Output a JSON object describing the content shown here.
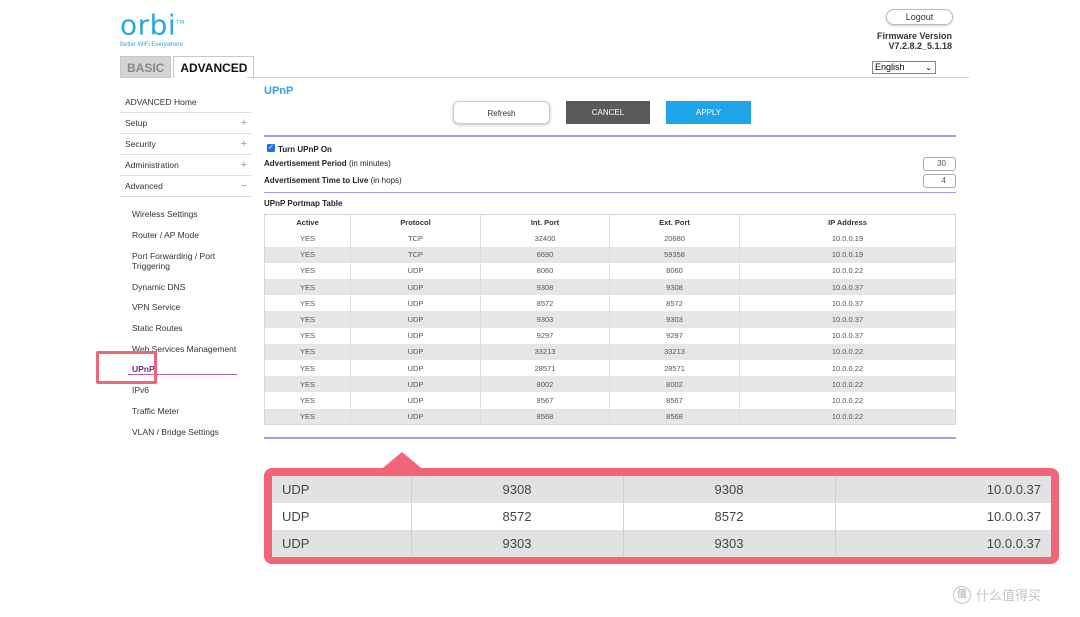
{
  "brand": {
    "logo": "orbi",
    "trademark": "TM",
    "tagline": "Better WiFi Everywhere"
  },
  "header": {
    "logout": "Logout",
    "firmware_label": "Firmware Version",
    "firmware_version": "V7.2.8.2_5.1.18",
    "language": "English",
    "tabs": [
      "BASIC",
      "ADVANCED"
    ]
  },
  "sidebar": {
    "items": [
      {
        "label": "ADVANCED Home",
        "expand": ""
      },
      {
        "label": "Setup",
        "expand": "+"
      },
      {
        "label": "Security",
        "expand": "+"
      },
      {
        "label": "Administration",
        "expand": "+"
      },
      {
        "label": "Advanced",
        "expand": "−"
      }
    ],
    "sub_items": [
      "Wireless Settings",
      "Router / AP Mode",
      "Port Forwarding / Port Triggering",
      "Dynamic DNS",
      "VPN Service",
      "Static Routes",
      "Web Services Management",
      "UPnP",
      "IPv6",
      "Traffic Meter",
      "VLAN / Bridge Settings"
    ]
  },
  "main": {
    "title": "UPnP",
    "buttons": {
      "refresh": "Refresh",
      "cancel": "CANCEL",
      "apply": "APPLY"
    },
    "upnp_on_label": "Turn UPnP On",
    "adv_period_label": "Advertisement Period",
    "adv_period_unit": "(in minutes)",
    "adv_period_value": "30",
    "adv_ttl_label": "Advertisement Time to Live",
    "adv_ttl_unit": "(in hops)",
    "adv_ttl_value": "4",
    "table_title": "UPnP Portmap Table",
    "table_headers": [
      "Active",
      "Protocol",
      "Int. Port",
      "Ext. Port",
      "IP Address"
    ],
    "table_rows": [
      [
        "YES",
        "TCP",
        "32400",
        "20680",
        "10.0.0.19"
      ],
      [
        "YES",
        "TCP",
        "6690",
        "59358",
        "10.0.0.19"
      ],
      [
        "YES",
        "UDP",
        "8060",
        "8060",
        "10.0.0.22"
      ],
      [
        "YES",
        "UDP",
        "9308",
        "9308",
        "10.0.0.37"
      ],
      [
        "YES",
        "UDP",
        "8572",
        "8572",
        "10.0.0.37"
      ],
      [
        "YES",
        "UDP",
        "9303",
        "9303",
        "10.0.0.37"
      ],
      [
        "YES",
        "UDP",
        "9297",
        "9297",
        "10.0.0.37"
      ],
      [
        "YES",
        "UDP",
        "33213",
        "33213",
        "10.0.0.22"
      ],
      [
        "YES",
        "UDP",
        "28571",
        "28571",
        "10.0.0.22"
      ],
      [
        "YES",
        "UDP",
        "8002",
        "8002",
        "10.0.0.22"
      ],
      [
        "YES",
        "UDP",
        "8567",
        "8567",
        "10.0.0.22"
      ],
      [
        "YES",
        "UDP",
        "8568",
        "8568",
        "10.0.0.22"
      ]
    ]
  },
  "zoom": {
    "rows": [
      [
        "UDP",
        "9308",
        "9308",
        "10.0.0.37"
      ],
      [
        "UDP",
        "8572",
        "8572",
        "10.0.0.37"
      ],
      [
        "UDP",
        "9303",
        "9303",
        "10.0.0.37"
      ]
    ]
  },
  "watermark": {
    "icon": "值",
    "text": "什么值得买"
  },
  "colors": {
    "accent": "#3a9fd6",
    "apply": "#1fa4e8",
    "highlight": "#f2647a",
    "rule": "#a89ae0",
    "active_nav": "#6b2c8e"
  }
}
